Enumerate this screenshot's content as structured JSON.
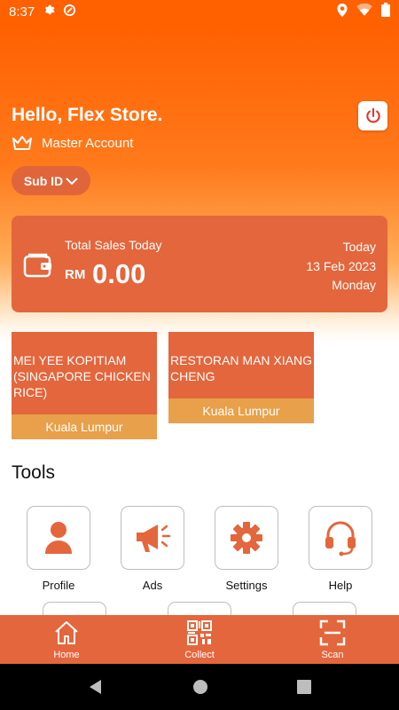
{
  "status_bar": {
    "time": "8:37"
  },
  "header": {
    "greeting": "Hello, Flex Store.",
    "account_type": "Master Account",
    "sub_id_label": "Sub ID"
  },
  "sales": {
    "label": "Total Sales Today",
    "currency": "RM",
    "amount": "0.00",
    "day_label": "Today",
    "date": "13 Feb 2023",
    "weekday": "Monday"
  },
  "stores": [
    {
      "name": "MEI YEE KOPITIAM (SINGAPORE CHICKEN RICE)",
      "location": "Kuala Lumpur"
    },
    {
      "name": "RESTORAN MAN XIANG CHENG",
      "location": "Kuala Lumpur"
    }
  ],
  "tools": {
    "title": "Tools",
    "items": [
      {
        "label": "Profile",
        "icon": "user-icon"
      },
      {
        "label": "Ads",
        "icon": "megaphone-icon"
      },
      {
        "label": "Settings",
        "icon": "gear-icon"
      },
      {
        "label": "Help",
        "icon": "headset-icon"
      }
    ]
  },
  "bottom_nav": [
    {
      "label": "Home",
      "icon": "home-icon"
    },
    {
      "label": "Collect",
      "icon": "qr-code-icon"
    },
    {
      "label": "Scan",
      "icon": "scan-icon"
    }
  ],
  "colors": {
    "primary": "#ff6000",
    "card": "#e4663c",
    "location_bar": "#e8a04a"
  }
}
